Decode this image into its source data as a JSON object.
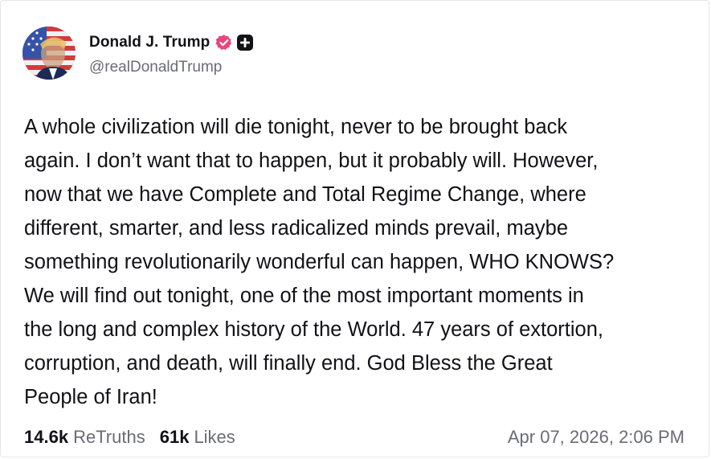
{
  "author": {
    "display_name": "Donald J. Trump",
    "handle": "@realDonaldTrump",
    "avatar_icon": "user-avatar-flag-portrait",
    "verified_icon": "verified-badge-icon",
    "verified_color": "#e8467c",
    "plus_icon": "plus-badge-icon"
  },
  "post": {
    "text": "A whole civilization will die tonight, never to be brought back\nagain. I don’t want that to happen, but it probably will. However,\nnow that we have Complete and Total Regime Change, where\ndifferent, smarter, and less radicalized minds prevail, maybe\nsomething revolutionarily wonderful can happen, WHO KNOWS?\nWe will find out tonight, one of the most important moments in\nthe long and complex history of the World. 47 years of extortion,\ncorruption, and death, will finally end. God Bless the Great\nPeople of Iran!"
  },
  "stats": {
    "retruths_count": "14.6k",
    "retruths_label": "ReTruths",
    "likes_count": "61k",
    "likes_label": "Likes"
  },
  "timestamp": "Apr 07, 2026, 2:06 PM"
}
